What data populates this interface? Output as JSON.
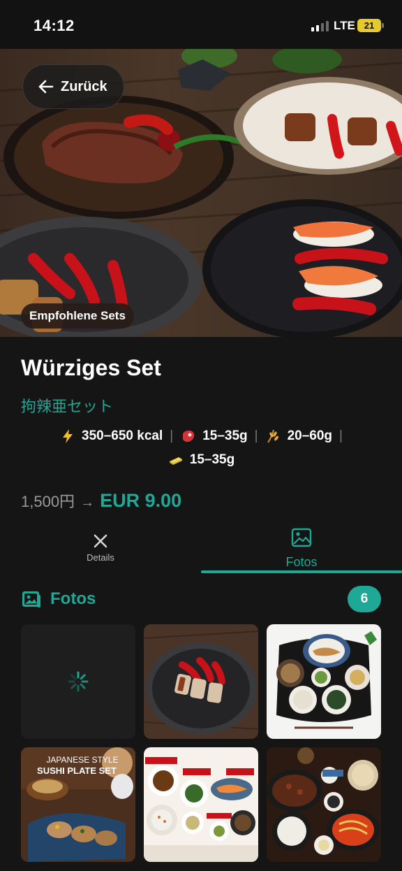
{
  "status_bar": {
    "time": "14:12",
    "network": "LTE",
    "battery": "21"
  },
  "header": {
    "back_label": "Zurück",
    "badge": "Empfohlene Sets"
  },
  "set": {
    "title": "Würziges Set",
    "subtitle": "拘辣亜セット",
    "stats": {
      "calories": "350–650 kcal",
      "protein": "15–35g",
      "carbs": "20–60g",
      "fat": "15–35g"
    },
    "price_old": "1,500円",
    "price_arrow": "→",
    "price_new": "EUR 9.00"
  },
  "tabs": [
    {
      "label": "Details",
      "icon": "utensils-icon",
      "active": false
    },
    {
      "label": "Fotos",
      "icon": "photo-icon",
      "active": true
    }
  ],
  "photos_section": {
    "title": "Fotos",
    "count": "6",
    "thumbnails": [
      {
        "name": "photo-loading",
        "state": "loading"
      },
      {
        "name": "photo-spicy-plate"
      },
      {
        "name": "photo-set-meal-tray"
      },
      {
        "name": "photo-sushi-plate-set",
        "overlay_text_line1": "JAPANESE STYLE",
        "overlay_text_line2": "SUSHI PLATE SET"
      },
      {
        "name": "photo-side-dishes"
      },
      {
        "name": "photo-hot-pot-set"
      }
    ]
  },
  "colors": {
    "accent": "#1fa896",
    "background": "#151515"
  }
}
